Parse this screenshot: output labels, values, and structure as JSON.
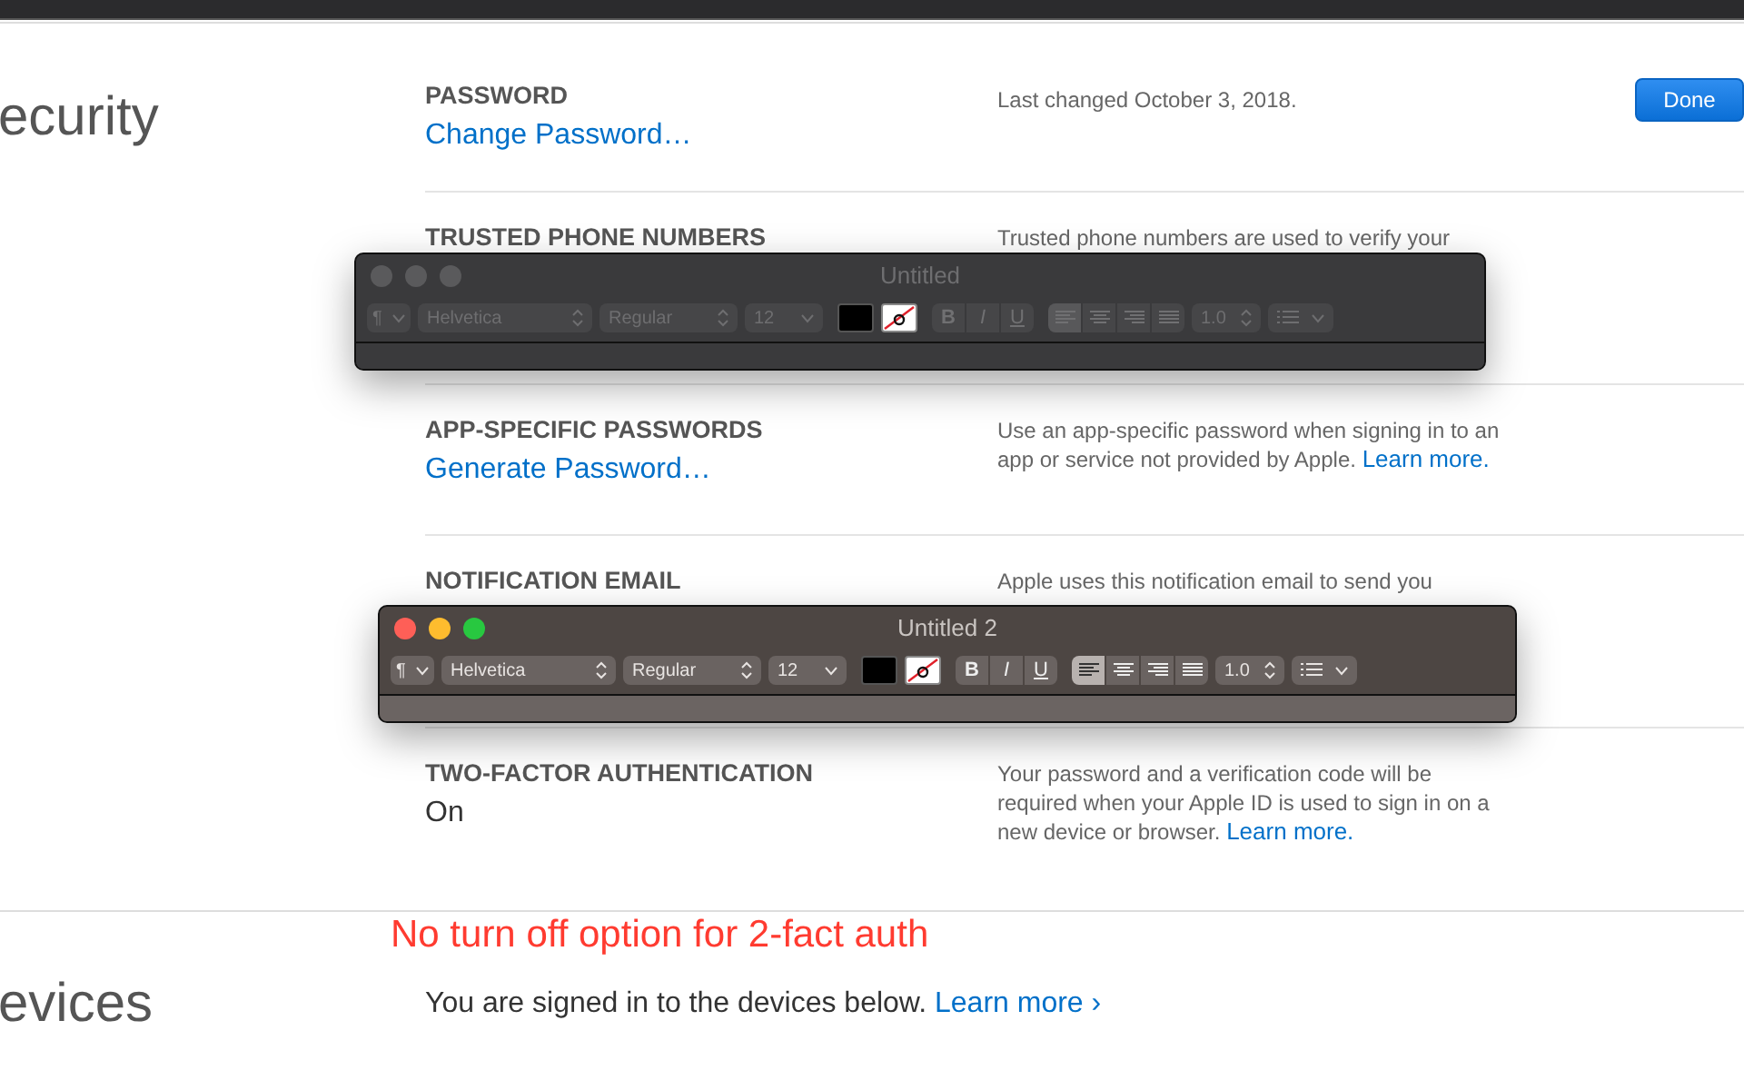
{
  "page": {
    "section_title": "ecurity",
    "done_button": "Done",
    "rows": [
      {
        "label": "PASSWORD",
        "link": "Change Password…",
        "description": "Last changed October 3, 2018."
      },
      {
        "label": "TRUSTED PHONE NUMBERS",
        "description": "Trusted phone numbers are used to verify your"
      },
      {
        "label": "APP-SPECIFIC PASSWORDS",
        "link": "Generate Password…",
        "description": "Use an app-specific password when signing in to an app or service not provided by Apple.",
        "description_link": "Learn more."
      },
      {
        "label": "NOTIFICATION EMAIL",
        "description": "Apple uses this notification email to send you"
      },
      {
        "label": "TWO-FACTOR AUTHENTICATION",
        "value": "On",
        "description": "Your password and a verification code will be required when your Apple ID is used to sign in on a new device or browser.",
        "description_link": "Learn more."
      }
    ]
  },
  "devices": {
    "title": "evices",
    "text": "You are signed in to the devices below.",
    "link": "Learn more",
    "link_chevron": "›"
  },
  "annotation": "No turn off option for 2-fact auth",
  "windows": [
    {
      "title": "Untitled",
      "active": false,
      "paragraph": "¶",
      "font": "Helvetica",
      "typeface": "Regular",
      "size": "12",
      "bold": "B",
      "italic": "I",
      "underline": "U",
      "alignments": [
        {
          "kind": "left",
          "selected": true
        },
        {
          "kind": "center",
          "selected": false
        },
        {
          "kind": "right",
          "selected": false
        },
        {
          "kind": "justify",
          "selected": false
        }
      ],
      "spacing": "1.0"
    },
    {
      "title": "Untitled 2",
      "active": true,
      "paragraph": "¶",
      "font": "Helvetica",
      "typeface": "Regular",
      "size": "12",
      "bold": "B",
      "italic": "I",
      "underline": "U",
      "alignments": [
        {
          "kind": "left",
          "selected": true
        },
        {
          "kind": "center",
          "selected": false
        },
        {
          "kind": "right",
          "selected": false
        },
        {
          "kind": "justify",
          "selected": false
        }
      ],
      "spacing": "1.0"
    }
  ]
}
